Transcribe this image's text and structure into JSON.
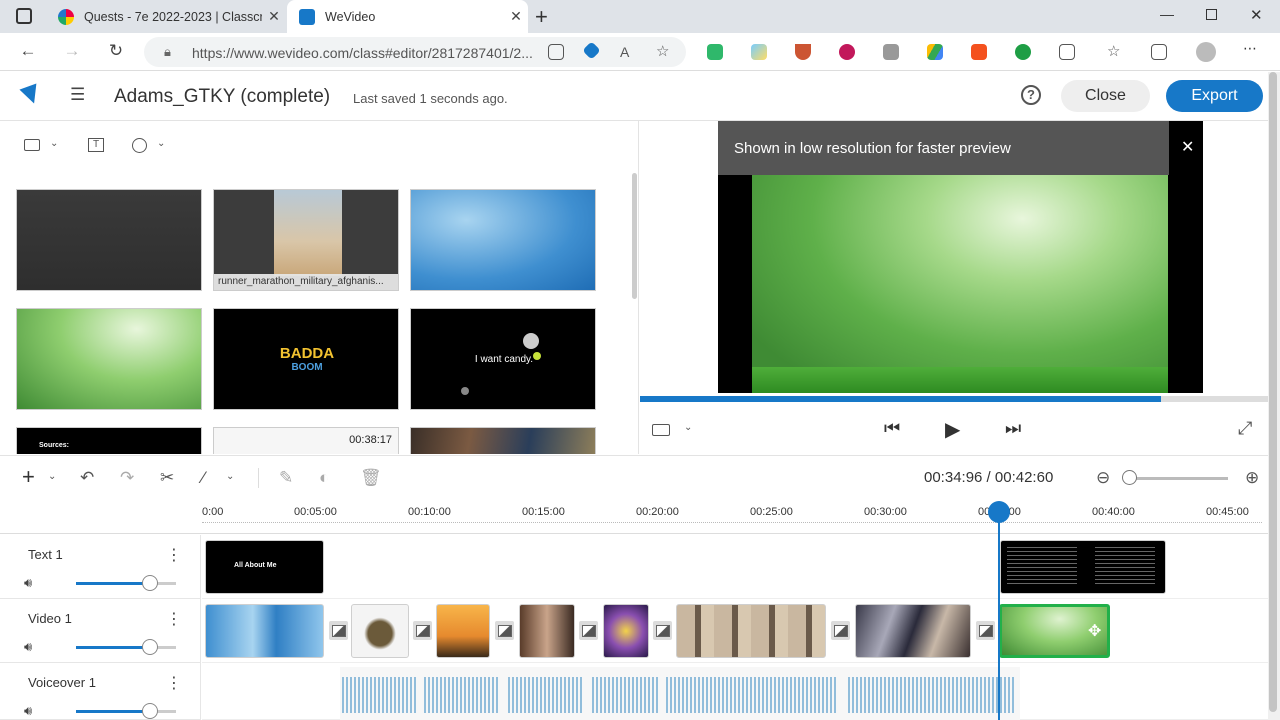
{
  "browser": {
    "tabs": [
      {
        "title": "Quests - 7e 2022-2023 | Classcra",
        "active": false
      },
      {
        "title": "WeVideo",
        "active": true
      }
    ],
    "url": "https://www.wevideo.com/class#editor/2817287401/2...",
    "new_tab": "+"
  },
  "app": {
    "project_title": "Adams_GTKY (complete)",
    "saved_status": "Last saved 1 seconds ago.",
    "help_label": "?",
    "close_label": "Close",
    "export_label": "Export",
    "accent": "#1778c8"
  },
  "media": {
    "items": [
      {
        "caption": "",
        "duration": ""
      },
      {
        "caption": "runner_marathon_military_afghanis...",
        "duration": ""
      },
      {
        "caption": "",
        "duration": ""
      },
      {
        "caption": "",
        "duration": ""
      },
      {
        "caption": "BADDA",
        "caption2": "BOOM"
      },
      {
        "caption": "I want candy."
      },
      {
        "caption": "Sources:"
      },
      {
        "caption": "",
        "duration": "00:38:17"
      },
      {
        "caption": ""
      }
    ]
  },
  "preview": {
    "banner": "Shown in low resolution for faster preview",
    "progress": 0.83
  },
  "timeline": {
    "timecode": "00:34:96 / 00:42:60",
    "ruler": [
      "0:00",
      "00:05:00",
      "00:10:00",
      "00:15:00",
      "00:20:00",
      "00:25:00",
      "00:30:00",
      "00:35:00",
      "00:40:00",
      "00:45:00"
    ],
    "tracks": [
      {
        "name": "Text 1",
        "volume": 0.74
      },
      {
        "name": "Video 1",
        "volume": 0.74
      },
      {
        "name": "Voiceover 1",
        "volume": 0.74
      }
    ],
    "text_clip_label": "All About Me"
  }
}
